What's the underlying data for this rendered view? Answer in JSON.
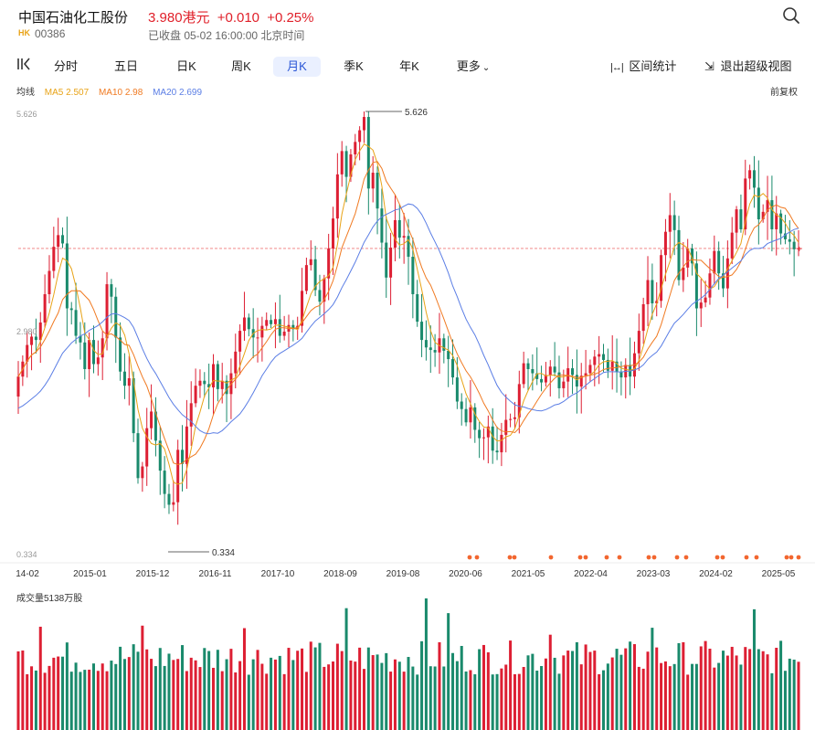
{
  "header": {
    "name": "中国石油化工股份",
    "price": "3.980港元",
    "change": "+0.010",
    "change_pct": "+0.25%",
    "market": "HK",
    "code": "00386",
    "status": "已收盘 05-02 16:00:00 北京时间"
  },
  "toolbar": {
    "tabs": [
      "分时",
      "五日",
      "日K",
      "周K",
      "月K",
      "季K",
      "年K",
      "更多"
    ],
    "active_tab": "月K",
    "range_stats": "区间统计",
    "exit_fullscreen": "退出超级视图"
  },
  "indicators": {
    "label": "均线",
    "ma5": "MA5 2.507",
    "ma10": "MA10 2.98",
    "ma20": "MA20 2.699",
    "adjust": "前复权"
  },
  "volume_label": "成交量5138万股",
  "colors": {
    "up": "#dd1f33",
    "down": "#1a8a6c",
    "ma5": "#e8a317",
    "ma10": "#f07a22",
    "ma20": "#5b7ee5",
    "accent": "#2a56d6"
  },
  "chart_data": {
    "type": "candlestick",
    "frequency": "monthly",
    "y_axis": {
      "min": 0.334,
      "max": 5.626,
      "labels": [
        "5.626",
        "2.980",
        "0.334"
      ]
    },
    "reference_price": 3.98,
    "annotations": [
      {
        "label": "5.626",
        "kind": "high"
      },
      {
        "label": "0.334",
        "kind": "low"
      }
    ],
    "x_labels": [
      "14-02",
      "2015-01",
      "2015-12",
      "2016-11",
      "2017-10",
      "2018-09",
      "2019-08",
      "2020-06",
      "2021-05",
      "2022-04",
      "2023-03",
      "2024-02",
      "2025-05"
    ],
    "dividend_marker_count": 20,
    "closes": [
      2.44,
      2.62,
      2.82,
      2.92,
      2.88,
      3.09,
      3.43,
      3.71,
      4.0,
      4.14,
      4.04,
      3.26,
      3.24,
      2.93,
      2.85,
      2.53,
      2.88,
      2.59,
      2.67,
      2.9,
      3.55,
      3.4,
      2.91,
      2.5,
      2.33,
      2.42,
      1.76,
      1.22,
      1.36,
      1.82,
      2.02,
      1.67,
      1.31,
      1.03,
      0.9,
      0.93,
      1.56,
      1.39,
      1.84,
      2.12,
      2.33,
      2.39,
      2.35,
      2.31,
      2.59,
      2.29,
      2.39,
      2.23,
      2.48,
      2.74,
      2.99,
      3.15,
      3.01,
      2.91,
      2.91,
      3.05,
      3.12,
      3.07,
      3.13,
      2.93,
      2.98,
      3.06,
      3.01,
      3.05,
      3.47,
      3.78,
      3.85,
      3.48,
      3.34,
      3.62,
      3.98,
      4.34,
      4.87,
      5.15,
      4.84,
      5.11,
      5.26,
      5.4,
      5.56,
      4.7,
      4.89,
      4.46,
      4.05,
      3.63,
      3.99,
      4.32,
      4.11,
      4.13,
      3.88,
      3.43,
      3.1,
      2.88,
      2.79,
      2.76,
      2.73,
      2.9,
      2.75,
      2.65,
      2.43,
      2.14,
      2.05,
      1.89,
      2.07,
      1.8,
      1.7,
      1.71,
      1.84,
      1.55,
      1.53,
      1.74,
      1.92,
      1.93,
      1.95,
      2.35,
      2.6,
      2.53,
      2.48,
      2.41,
      2.37,
      2.46,
      2.56,
      2.49,
      2.3,
      2.38,
      2.54,
      2.46,
      2.32,
      2.45,
      2.48,
      2.58,
      2.68,
      2.71,
      2.64,
      2.51,
      2.62,
      2.5,
      2.43,
      2.58,
      2.44,
      2.72,
      2.99,
      3.31,
      3.6,
      3.32,
      3.35,
      3.9,
      4.18,
      4.38,
      4.2,
      3.6,
      3.75,
      3.98,
      3.8,
      3.26,
      3.33,
      3.39,
      3.68,
      3.95,
      3.68,
      3.5,
      3.86,
      4.17,
      4.45,
      4.21,
      4.82,
      4.92,
      4.71,
      4.33,
      4.42,
      4.56,
      4.21,
      4.4,
      4.16,
      4.09,
      4.06,
      3.97,
      3.98
    ],
    "ma20_start": 2.04,
    "volume_max": 5138
  }
}
